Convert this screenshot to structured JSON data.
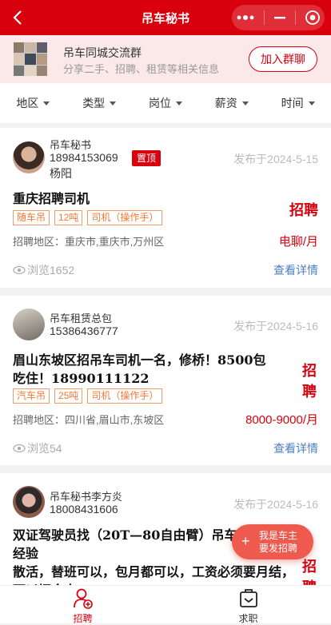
{
  "header": {
    "title": "吊车秘书"
  },
  "banner": {
    "title": "吊车同城交流群",
    "subtitle": "分享二手、招聘、租赁等相关信息",
    "join_label": "加入群聊"
  },
  "filters": [
    "地区",
    "类型",
    "岗位",
    "薪资",
    "时间"
  ],
  "posts": [
    {
      "user": "吊车秘书",
      "phone": "18984153069",
      "location": "杨阳",
      "badge": "置顶",
      "date": "发布于2024-5-15",
      "title": "重庆招聘司机",
      "tags": [
        "随车吊",
        "12吨",
        "司机（操作手）"
      ],
      "area": "招聘地区：重庆市,重庆市,万州区",
      "kind": "招聘",
      "salary": "电聊/月",
      "views": "浏览1652",
      "detail": "查看详情"
    },
    {
      "user": "吊车租赁总包",
      "phone": "15386436777",
      "date": "发布于2024-5-16",
      "title": "眉山东坡区招吊车司机一名，修桥！8500包吃住！18990111122",
      "tags": [
        "汽车吊",
        "25吨",
        "司机（操作手）"
      ],
      "area": "招聘地区：四川省,眉山市,东坡区",
      "kind": "招聘",
      "salary": "8000-9000/月",
      "views": "浏览54",
      "detail": "查看详情"
    },
    {
      "user": "吊车秘书李方炎",
      "phone": "18008431606",
      "date": "发布于2024-5-16",
      "title_line1": "双证驾驶员找（20T—80自由臂）吊车，有",
      "title_line2": "经验",
      "title_line3": "散活，替班可以，包月都可以，工资必须要月结，",
      "title_line4": "可以招令人",
      "kind": "招聘"
    }
  ],
  "fab": {
    "line1": "我是车主",
    "line2": "要发招聘"
  },
  "tabs": [
    {
      "label": "招聘",
      "active": true
    },
    {
      "label": "求职",
      "active": false
    }
  ],
  "colors": {
    "brand": "#d9000e",
    "tag": "#f07a3a",
    "link": "#4a7fc1"
  }
}
